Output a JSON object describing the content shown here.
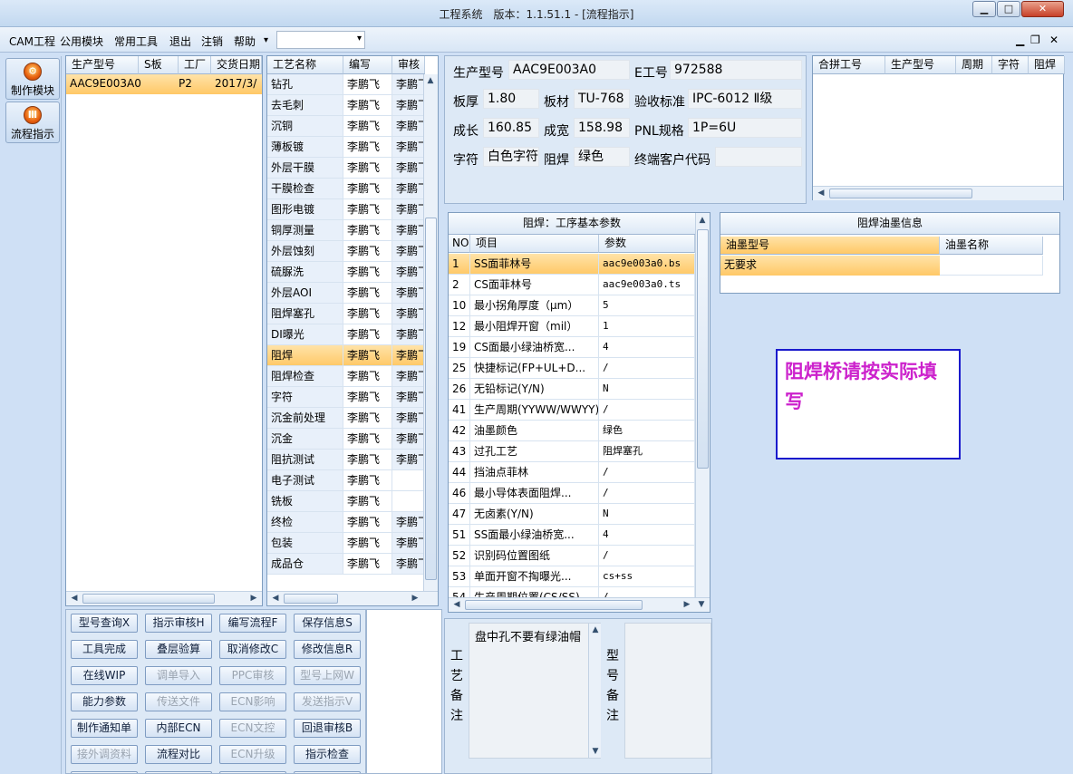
{
  "window": {
    "title": "工程系统　版本：1.1.51.1 - [流程指示]",
    "min": "▁",
    "max": "□",
    "close": "✕"
  },
  "menu": {
    "items": [
      "CAM工程",
      "公用模块",
      "常用工具",
      "退出",
      "注销",
      "帮助"
    ],
    "help_arrow": "▾",
    "combo_arrow": "▾",
    "mdi_min": "▁",
    "mdi_restore": "❐",
    "mdi_close": "✕"
  },
  "nav": [
    {
      "label": "制作模块",
      "icon": "gear-flame-icon",
      "glyph": "⚙"
    },
    {
      "label": "流程指示",
      "icon": "flow-icon",
      "glyph": "Ⅲ"
    }
  ],
  "orders": {
    "headers": [
      "生产型号",
      "S板",
      "工厂",
      "交货日期"
    ],
    "rows": [
      [
        "AAC9E003A0",
        "",
        "P2",
        "2017/3/"
      ]
    ]
  },
  "process": {
    "headers": [
      "工艺名称",
      "编写",
      "审核"
    ],
    "rows": [
      [
        "钻孔",
        "李鹏飞",
        "李鹏飞"
      ],
      [
        "去毛刺",
        "李鹏飞",
        "李鹏飞"
      ],
      [
        "沉铜",
        "李鹏飞",
        "李鹏飞"
      ],
      [
        "薄板镀",
        "李鹏飞",
        "李鹏飞"
      ],
      [
        "外层干膜",
        "李鹏飞",
        "李鹏飞"
      ],
      [
        "干膜检查",
        "李鹏飞",
        "李鹏飞"
      ],
      [
        "图形电镀",
        "李鹏飞",
        "李鹏飞"
      ],
      [
        "铜厚测量",
        "李鹏飞",
        "李鹏飞"
      ],
      [
        "外层蚀刻",
        "李鹏飞",
        "李鹏飞"
      ],
      [
        "硫脲洗",
        "李鹏飞",
        "李鹏飞"
      ],
      [
        "外层AOI",
        "李鹏飞",
        "李鹏飞"
      ],
      [
        "阻焊塞孔",
        "李鹏飞",
        "李鹏飞"
      ],
      [
        "DI曝光",
        "李鹏飞",
        "李鹏飞"
      ],
      [
        "阻焊",
        "李鹏飞",
        "李鹏飞"
      ],
      [
        "阻焊检查",
        "李鹏飞",
        "李鹏飞"
      ],
      [
        "字符",
        "李鹏飞",
        "李鹏飞"
      ],
      [
        "沉金前处理",
        "李鹏飞",
        "李鹏飞"
      ],
      [
        "沉金",
        "李鹏飞",
        "李鹏飞"
      ],
      [
        "阻抗测试",
        "李鹏飞",
        "李鹏飞"
      ],
      [
        "电子测试",
        "李鹏飞",
        ""
      ],
      [
        "铣板",
        "李鹏飞",
        ""
      ],
      [
        "终检",
        "李鹏飞",
        "李鹏飞"
      ],
      [
        "包装",
        "李鹏飞",
        "李鹏飞"
      ],
      [
        "成品仓",
        "李鹏飞",
        "李鹏飞"
      ]
    ],
    "selected_index": 13
  },
  "info": {
    "row1": [
      {
        "label": "生产型号",
        "value": "AAC9E003A0"
      },
      {
        "label": "E工号",
        "value": "972588"
      }
    ],
    "row2": [
      {
        "label": "板厚",
        "value": "1.80"
      },
      {
        "label": "板材",
        "value": "TU-768"
      },
      {
        "label": "验收标准",
        "value": "IPC-6012 Ⅱ级"
      }
    ],
    "row3": [
      {
        "label": "成长",
        "value": "160.85"
      },
      {
        "label": "成宽",
        "value": "158.98"
      },
      {
        "label": "PNL规格",
        "value": "1P=6U"
      }
    ],
    "row4": [
      {
        "label": "字符",
        "value": "白色字符"
      },
      {
        "label": "阻焊",
        "value": "绿色"
      },
      {
        "label": "终端客户代码",
        "value": ""
      }
    ]
  },
  "combine": {
    "headers": [
      "合拼工号",
      "生产型号",
      "周期",
      "字符",
      "阻焊"
    ]
  },
  "params": {
    "title": "阻焊：工序基本参数",
    "headers": [
      "NO",
      "项目",
      "参数"
    ],
    "rows": [
      [
        "1",
        "SS面菲林号",
        "aac9e003a0.bs"
      ],
      [
        "2",
        "CS面菲林号",
        "aac9e003a0.ts"
      ],
      [
        "10",
        "最小拐角厚度（μm）",
        "5"
      ],
      [
        "12",
        "最小阻焊开窗（mil）",
        "1"
      ],
      [
        "19",
        "CS面最小绿油桥宽...",
        "4"
      ],
      [
        "25",
        "快捷标记(FP+UL+D...",
        "/"
      ],
      [
        "26",
        "无铅标记(Y/N)",
        "N"
      ],
      [
        "41",
        "生产周期(YYWW/WWYY)",
        "/"
      ],
      [
        "42",
        "油墨颜色",
        "绿色"
      ],
      [
        "43",
        "过孔工艺",
        "阻焊塞孔"
      ],
      [
        "44",
        "挡油点菲林",
        "/"
      ],
      [
        "46",
        "最小导体表面阻焊...",
        "/"
      ],
      [
        "47",
        "无卤素(Y/N)",
        "N"
      ],
      [
        "51",
        "SS面最小绿油桥宽...",
        "4"
      ],
      [
        "52",
        "识别码位置图纸",
        "/"
      ],
      [
        "53",
        "单面开窗不掏曝光...",
        "cs+ss"
      ],
      [
        "54",
        "生产周期位置(CS/SS)",
        "/"
      ]
    ]
  },
  "ink": {
    "title": "阻焊油墨信息",
    "headers": [
      "油墨型号",
      "油墨名称"
    ],
    "rows": [
      [
        "无要求",
        ""
      ]
    ]
  },
  "note": {
    "text": "阻焊桥请按实际填写",
    "color": "#cc22cc"
  },
  "remarks": {
    "process_label": "工艺备注",
    "process_text": "盘中孔不要有绿油帽",
    "model_label": "型号备注"
  },
  "buttons": [
    [
      {
        "label": "型号查询X",
        "enabled": true
      },
      {
        "label": "指示审核H",
        "enabled": true
      },
      {
        "label": "编写流程F",
        "enabled": true
      },
      {
        "label": "保存信息S",
        "enabled": true
      }
    ],
    [
      {
        "label": "工具完成",
        "enabled": true
      },
      {
        "label": "叠层验算",
        "enabled": true
      },
      {
        "label": "取消修改C",
        "enabled": true
      },
      {
        "label": "修改信息R",
        "enabled": true
      }
    ],
    [
      {
        "label": "在线WIP",
        "enabled": true
      },
      {
        "label": "调单导入",
        "enabled": false
      },
      {
        "label": "PPC审核",
        "enabled": false
      },
      {
        "label": "型号上网W",
        "enabled": false
      }
    ],
    [
      {
        "label": "能力参数",
        "enabled": true
      },
      {
        "label": "传送文件",
        "enabled": false
      },
      {
        "label": "ECN影响",
        "enabled": false
      },
      {
        "label": "发送指示V",
        "enabled": false
      }
    ],
    [
      {
        "label": "制作通知单",
        "enabled": true
      },
      {
        "label": "内部ECN",
        "enabled": true
      },
      {
        "label": "ECN文控",
        "enabled": false
      },
      {
        "label": "回退审核B",
        "enabled": true
      }
    ],
    [
      {
        "label": "接外调资料",
        "enabled": false
      },
      {
        "label": "流程对比",
        "enabled": true
      },
      {
        "label": "ECN升级",
        "enabled": false
      },
      {
        "label": "指示检查",
        "enabled": true
      }
    ]
  ],
  "colors": {
    "selected": "#ffc866",
    "accent": "#1a1acc"
  }
}
